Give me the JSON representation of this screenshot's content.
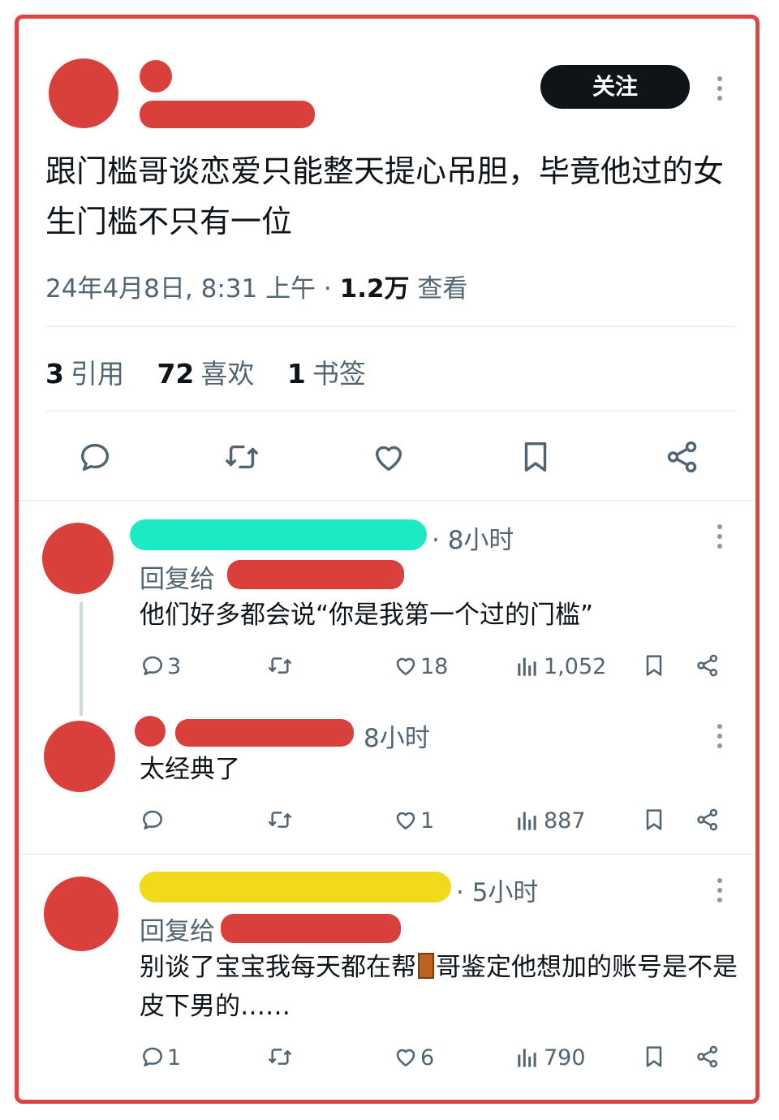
{
  "post": {
    "follow_label": "关注",
    "text": "跟门槛哥谈恋爱只能整天提心吊胆，毕竟他过的女生门槛不只有一位",
    "date": "24年4月8日, 8:31 上午 · ",
    "views_count": "1.2万",
    "views_label": " 查看",
    "stats": [
      {
        "count": "3",
        "label": "引用"
      },
      {
        "count": "72",
        "label": "喜欢"
      },
      {
        "count": "1",
        "label": "书签"
      }
    ]
  },
  "comments": [
    {
      "time": "· 8小时",
      "reply_to_label": "回复给",
      "text": "他们好多都会说“你是我第一个过的门槛”",
      "replies": "3",
      "likes": "18",
      "views": "1,052"
    },
    {
      "time": "8小时",
      "text": "太经典了",
      "replies": "",
      "likes": "1",
      "views": "887"
    },
    {
      "time": "· 5小时",
      "reply_to_label": "回复给",
      "text_before": "别谈了宝宝我每天都在帮",
      "text_after": "哥鉴定他想加的账号是不是皮下男的……",
      "replies": "1",
      "likes": "6",
      "views": "790"
    }
  ],
  "icons": {
    "main_actions": [
      "reply-icon",
      "retweet-icon",
      "like-icon",
      "bookmark-icon",
      "share-icon"
    ],
    "comment_actions": [
      "reply-icon",
      "retweet-icon",
      "like-icon",
      "views-icon",
      "bookmark-icon",
      "share-icon"
    ],
    "emoji": "door-emoji-icon"
  },
  "colors": {
    "frame_border": "#e04343",
    "redaction_red": "#d9403c",
    "redaction_teal": "#1de9c3",
    "redaction_yellow": "#f1da1c",
    "text_primary": "#0f1419",
    "text_secondary": "#536471"
  }
}
